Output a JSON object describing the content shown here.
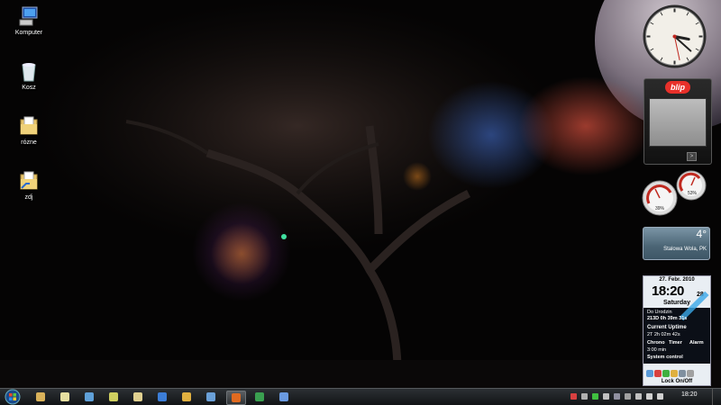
{
  "desktop": {
    "icons": [
      {
        "label": "Komputer",
        "icon": "computer-icon"
      },
      {
        "label": "Kosz",
        "icon": "recycle-bin-icon"
      },
      {
        "label": "rózne",
        "icon": "folder-icon"
      },
      {
        "label": "zdj",
        "icon": "folder-icon"
      }
    ]
  },
  "gadgets": {
    "clock": {
      "hour": 3,
      "minute": 22,
      "second": 28
    },
    "blip": {
      "logo_text": "blip",
      "next_label": ">"
    },
    "meters": {
      "cpu_label": "39%",
      "ram_label": "53%"
    },
    "weather": {
      "temperature": "4°",
      "location": "Stalowa Wola, PK"
    },
    "panel": {
      "date": "27. Febr. 2010",
      "time": "18:20",
      "seconds": "28",
      "weekday": "Saturday",
      "birthday_label": "Do Urodzin",
      "birthday_value": "213D 0h 39m 31s",
      "uptime_label": "Current Uptime",
      "uptime_value": "2T 2h 02m 42s",
      "chrono": "Chrono",
      "timer": "Timer",
      "alarm": "Alarm",
      "time_small": "3:00 min",
      "system_control": "System control",
      "lock": "Lock On/Off"
    }
  },
  "taskbar": {
    "clock": "18:20",
    "apps": [
      {
        "name": "explorer",
        "color": "#d9b25a"
      },
      {
        "name": "notepad",
        "color": "#e6dfa0"
      },
      {
        "name": "image-viewer",
        "color": "#5fa0d8"
      },
      {
        "name": "tool",
        "color": "#cfcf60"
      },
      {
        "name": "documents",
        "color": "#e0d090"
      },
      {
        "name": "network",
        "color": "#3c7ed8"
      },
      {
        "name": "media",
        "color": "#e0b040"
      },
      {
        "name": "browser",
        "color": "#6aa0d8"
      },
      {
        "name": "firefox",
        "color": "#e06a20",
        "active": true
      },
      {
        "name": "spreadsheet",
        "color": "#3aa050"
      },
      {
        "name": "monitor",
        "color": "#6a9ae0"
      }
    ],
    "tray": [
      {
        "name": "tray-app",
        "color": "#d84040"
      },
      {
        "name": "tray-app",
        "color": "#b0b0b0"
      },
      {
        "name": "tray-app",
        "color": "#40c040"
      },
      {
        "name": "tray-app",
        "color": "#c0c0c0"
      },
      {
        "name": "tray-app",
        "color": "#9090a0"
      },
      {
        "name": "tray-app",
        "color": "#a0a0a0"
      },
      {
        "name": "tray-app",
        "color": "#c0c0c0"
      },
      {
        "name": "volume",
        "color": "#d0d0d0"
      },
      {
        "name": "network",
        "color": "#d0d0d0"
      }
    ]
  }
}
